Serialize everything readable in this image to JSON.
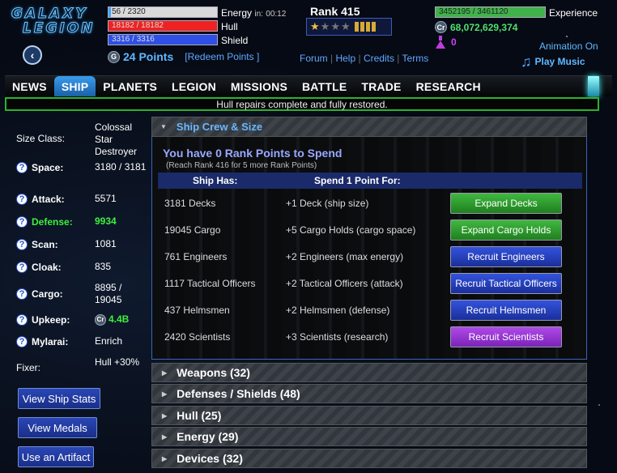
{
  "app": {
    "logo_line1": "GALAXY",
    "logo_line2": "LEGION"
  },
  "colors": {
    "accent": "#5fb8ff",
    "positive": "#3ef03e",
    "nav_active": "#2a7fd0",
    "button_green": "#2f9a2f",
    "button_blue": "#2542c4",
    "button_purple": "#9437d0"
  },
  "stats": {
    "energy": {
      "value": "56 / 2320",
      "label": "Energy",
      "timer_prefix": "in:",
      "timer": "00:12",
      "fill": 0.024
    },
    "hull": {
      "value": "18182 / 18182",
      "label": "Hull",
      "fill": 1.0
    },
    "shield": {
      "value": "3316 / 3316",
      "label": "Shield",
      "fill": 1.0
    }
  },
  "points": {
    "text": "24 Points",
    "redeem_label": "[Redeem Points ]"
  },
  "rank": {
    "label": "Rank 415",
    "stars_filled": 1,
    "stars_total": 4,
    "bars": 4
  },
  "top_links": [
    "Forum",
    "Help",
    "Credits",
    "Terms"
  ],
  "experience": {
    "value": "3452195 / 3461120",
    "label": "Experience",
    "fill": 0.997
  },
  "credits": {
    "value": "68,072,629,374"
  },
  "mylarai": {
    "value": "0"
  },
  "animation_label": "Animation On",
  "music_label": "Play Music",
  "nav": {
    "tabs": [
      "NEWS",
      "SHIP",
      "PLANETS",
      "LEGION",
      "MISSIONS",
      "BATTLE",
      "TRADE",
      "RESEARCH"
    ],
    "active": "SHIP"
  },
  "notice": "Hull repairs complete and fully restored.",
  "sidebar": {
    "size_class_label": "Size Class:",
    "size_class_value": "Colossal Star Destroyer",
    "stats": [
      {
        "label": "Space:",
        "value": "3180 / 3181"
      },
      {
        "label": "Attack:",
        "value": "5571"
      },
      {
        "label": "Defense:",
        "value": "9934"
      },
      {
        "label": "Scan:",
        "value": "1081"
      },
      {
        "label": "Cloak:",
        "value": "835"
      },
      {
        "label": "Cargo:",
        "value": "8895 / 19045"
      },
      {
        "label": "Upkeep:",
        "value": "4.4B"
      },
      {
        "label": "Mylarai:",
        "value": "Enrich"
      }
    ],
    "fixer_label": "Fixer:",
    "fixer_value": "Hull +30%",
    "buttons": [
      "View Ship Stats",
      "View Medals",
      "Use an Artifact"
    ]
  },
  "crew_panel": {
    "title": "Ship Crew & Size",
    "rank_points_title": "You have 0 Rank Points to Spend",
    "rank_points_sub": "(Reach Rank 416 for 5 more Rank Points)",
    "col_has": "Ship Has:",
    "col_spend": "Spend 1 Point For:",
    "rows": [
      {
        "has": "3181 Decks",
        "spend": "+1 Deck (ship size)",
        "button": "Expand Decks",
        "color": "green"
      },
      {
        "has": "19045 Cargo",
        "spend": "+5 Cargo Holds (cargo space)",
        "button": "Expand Cargo Holds",
        "color": "green"
      },
      {
        "has": "761 Engineers",
        "spend": "+2 Engineers (max energy)",
        "button": "Recruit Engineers",
        "color": "blue"
      },
      {
        "has": "1117 Tactical Officers",
        "spend": "+2 Tactical Officers (attack)",
        "button": "Recruit Tactical Officers",
        "color": "blue"
      },
      {
        "has": "437 Helmsmen",
        "spend": "+2 Helmsmen (defense)",
        "button": "Recruit Helmsmen",
        "color": "blue"
      },
      {
        "has": "2420 Scientists",
        "spend": "+3 Scientists (research)",
        "button": "Recruit Scientists",
        "color": "purple"
      }
    ]
  },
  "sections": [
    "Weapons (32)",
    "Defenses / Shields (48)",
    "Hull (25)",
    "Energy (29)",
    "Devices (32)"
  ]
}
